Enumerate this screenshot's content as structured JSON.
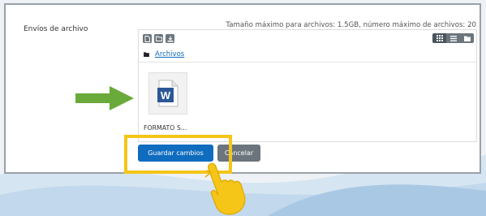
{
  "form": {
    "field_label": "Envíos de archivo",
    "max_info": "Tamaño máximo para archivos: 1.5GB, número máximo de archivos: 20"
  },
  "filepicker": {
    "toolbar": [
      "add-file-icon",
      "create-folder-icon",
      "download-icon"
    ],
    "view_modes": [
      "grid-view-icon",
      "list-view-icon",
      "tree-view-icon"
    ],
    "active_view": "grid-view-icon",
    "path_label": "Archivos",
    "files": [
      {
        "name": "FORMATO S...",
        "icon": "word-document-icon"
      }
    ]
  },
  "buttons": {
    "save_label": "Guardar cambios",
    "cancel_label": "Cancelar"
  },
  "colors": {
    "primary": "#0f6cbf",
    "secondary": "#6c757d",
    "highlight": "#f5c518",
    "arrow": "#6aaa3a"
  }
}
